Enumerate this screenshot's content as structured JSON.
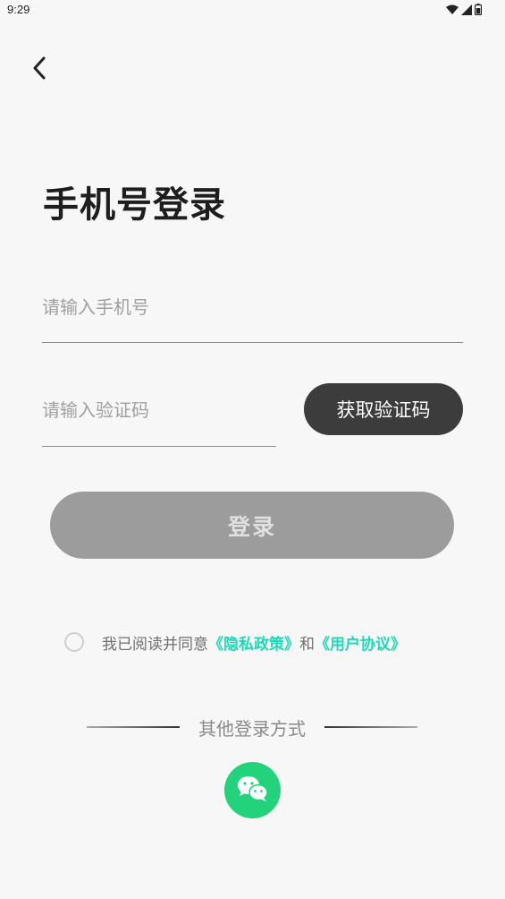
{
  "status_bar": {
    "time": "9:29",
    "icons": [
      "wifi-icon",
      "signal-icon",
      "battery-icon"
    ]
  },
  "header": {
    "back_icon": "chevron-left-icon"
  },
  "title": "手机号登录",
  "phone": {
    "placeholder": "请输入手机号",
    "value": ""
  },
  "code": {
    "placeholder": "请输入验证码",
    "value": "",
    "get_code_label": "获取验证码"
  },
  "login_button": "登录",
  "agreement": {
    "checked": false,
    "prefix": "我已阅读并同意",
    "privacy_link": "《隐私政策》",
    "conjunction": "和",
    "terms_link": "《用户协议》"
  },
  "other_login": {
    "label": "其他登录方式",
    "wechat_icon": "wechat-icon"
  },
  "colors": {
    "background": "#f7f7f7",
    "get_code_button": "#3c3c3c",
    "login_button_disabled": "#9c9c9c",
    "link": "#1fd9b6",
    "wechat": "#23d37c"
  }
}
